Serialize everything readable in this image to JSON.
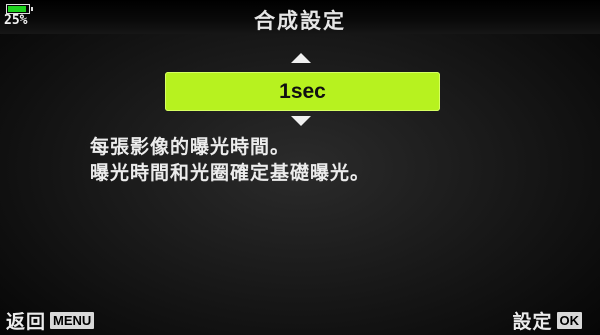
{
  "status": {
    "battery_percent": "25%",
    "battery_level": 0.9,
    "battery_color": "#1fd21f"
  },
  "header": {
    "title": "合成設定"
  },
  "selector": {
    "value": "1sec",
    "highlight_color": "#b7f21f",
    "up_icon": "arrow-up-icon",
    "down_icon": "arrow-down-icon"
  },
  "description": {
    "line1": "每張影像的曝光時間。",
    "line2": "曝光時間和光圈確定基礎曝光。"
  },
  "footer": {
    "back_label": "返回",
    "back_key": "MENU",
    "set_label": "設定",
    "set_key": "OK"
  }
}
